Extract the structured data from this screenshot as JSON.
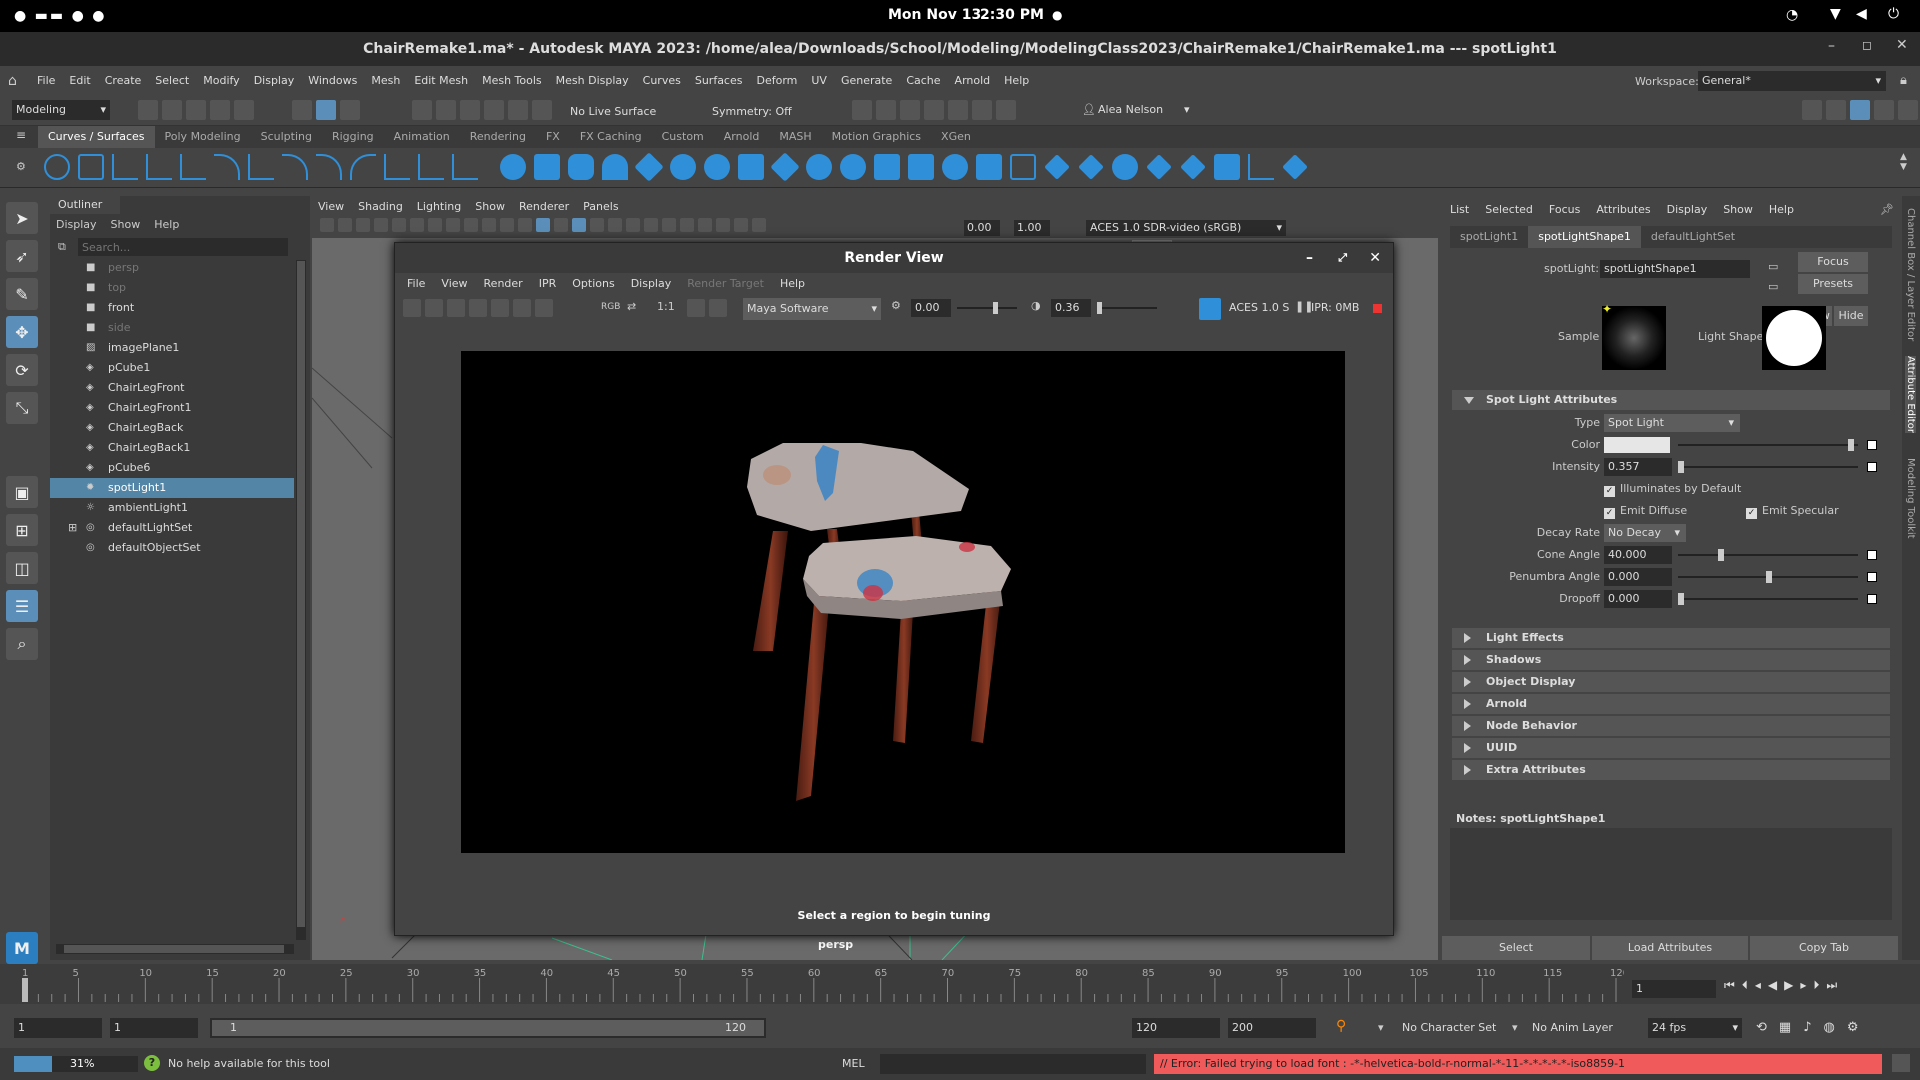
{
  "system": {
    "date": "Mon Nov 13",
    "time": "2:30 PM"
  },
  "window": {
    "title": "ChairRemake1.ma* - Autodesk MAYA 2023: /home/alea/Downloads/School/Modeling/ModelingClass2023/ChairRemake1/ChairRemake1.ma  ---  spotLight1"
  },
  "menu": [
    "File",
    "Edit",
    "Create",
    "Select",
    "Modify",
    "Display",
    "Windows",
    "Mesh",
    "Edit Mesh",
    "Mesh Tools",
    "Mesh Display",
    "Curves",
    "Surfaces",
    "Deform",
    "UV",
    "Generate",
    "Cache",
    "Arnold",
    "Help"
  ],
  "workspace": {
    "label": "Workspace:",
    "value": "General*"
  },
  "statusline": {
    "mode": "Modeling",
    "live_surface": "No Live Surface",
    "symmetry": "Symmetry: Off",
    "user": "Alea Nelson"
  },
  "shelf_tabs": [
    "Curves / Surfaces",
    "Poly Modeling",
    "Sculpting",
    "Rigging",
    "Animation",
    "Rendering",
    "FX",
    "FX Caching",
    "Custom",
    "Arnold",
    "MASH",
    "Motion Graphics",
    "XGen"
  ],
  "outliner": {
    "title": "Outliner",
    "menu": [
      "Display",
      "Show",
      "Help"
    ],
    "search_placeholder": "Search...",
    "items": [
      {
        "label": "persp",
        "icon": "camera-icon",
        "dim": true
      },
      {
        "label": "top",
        "icon": "camera-icon",
        "dim": true
      },
      {
        "label": "front",
        "icon": "camera-icon",
        "dim": false
      },
      {
        "label": "side",
        "icon": "camera-icon",
        "dim": true
      },
      {
        "label": "imagePlane1",
        "icon": "image-plane-icon",
        "dim": false
      },
      {
        "label": "pCube1",
        "icon": "mesh-icon",
        "dim": false
      },
      {
        "label": "ChairLegFront",
        "icon": "mesh-icon",
        "dim": false
      },
      {
        "label": "ChairLegFront1",
        "icon": "mesh-icon",
        "dim": false
      },
      {
        "label": "ChairLegBack",
        "icon": "mesh-icon",
        "dim": false
      },
      {
        "label": "ChairLegBack1",
        "icon": "mesh-icon",
        "dim": false
      },
      {
        "label": "pCube6",
        "icon": "mesh-icon",
        "dim": false
      },
      {
        "label": "spotLight1",
        "icon": "spotlight-icon",
        "dim": false,
        "selected": true
      },
      {
        "label": "ambientLight1",
        "icon": "ambient-light-icon",
        "dim": false
      },
      {
        "label": "defaultLightSet",
        "icon": "set-icon",
        "dim": false,
        "expandable": true
      },
      {
        "label": "defaultObjectSet",
        "icon": "set-icon",
        "dim": false
      }
    ]
  },
  "viewport": {
    "menu": [
      "View",
      "Shading",
      "Lighting",
      "Show",
      "Renderer",
      "Panels"
    ],
    "exposure": "0.00",
    "gamma": "1.00",
    "color_space": "ACES 1.0 SDR-video (sRGB)",
    "camera_label": "persp"
  },
  "render_view": {
    "title": "Render View",
    "menu": [
      "File",
      "View",
      "Render",
      "IPR",
      "Options",
      "Display",
      "Render Target",
      "Help"
    ],
    "renderer": "Maya Software",
    "exposure": "0.00",
    "gamma": "0.36",
    "color_space": "ACES 1.0 S",
    "ipr": "IPR: 0MB",
    "ratio": "1:1",
    "rgb": "RGB",
    "status": "Select a region to begin tuning"
  },
  "attr": {
    "menu": [
      "List",
      "Selected",
      "Focus",
      "Attributes",
      "Display",
      "Show",
      "Help"
    ],
    "tabs": [
      "spotLight1",
      "spotLightShape1",
      "defaultLightSet"
    ],
    "node_label": "spotLight:",
    "node_value": "spotLightShape1",
    "buttons": {
      "focus": "Focus",
      "presets": "Presets",
      "show": "Show",
      "hide": "Hide"
    },
    "sample_label": "Sample",
    "light_shape_label": "Light Shape",
    "section_open": "Spot Light Attributes",
    "type_label": "Type",
    "type_value": "Spot Light",
    "color_label": "Color",
    "intensity_label": "Intensity",
    "intensity_value": "0.357",
    "illuminates": "Illuminates by Default",
    "emit_diffuse": "Emit Diffuse",
    "emit_specular": "Emit Specular",
    "decay_label": "Decay Rate",
    "decay_value": "No Decay",
    "cone_label": "Cone Angle",
    "cone_value": "40.000",
    "penumbra_label": "Penumbra Angle",
    "penumbra_value": "0.000",
    "dropoff_label": "Dropoff",
    "dropoff_value": "0.000",
    "sections": [
      "Light Effects",
      "Shadows",
      "Object Display",
      "Arnold",
      "Node Behavior",
      "UUID",
      "Extra Attributes"
    ],
    "notes_label": "Notes:  spotLightShape1",
    "bottom_buttons": [
      "Select",
      "Load Attributes",
      "Copy Tab"
    ]
  },
  "side_tabs": [
    "Channel Box / Layer Editor",
    "Attribute Editor",
    "Modeling Toolkit"
  ],
  "timeline": {
    "ticks": [
      "1",
      "5",
      "10",
      "15",
      "20",
      "25",
      "30",
      "35",
      "40",
      "45",
      "50",
      "55",
      "60",
      "65",
      "70",
      "75",
      "80",
      "85",
      "90",
      "95",
      "100",
      "105",
      "110",
      "115",
      "120"
    ],
    "current_frame": "1"
  },
  "range": {
    "start": "1",
    "anim_start": "1",
    "slider_start": "1",
    "slider_end": "120",
    "end": "120",
    "anim_end": "200",
    "character_set": "No Character Set",
    "anim_layer": "No Anim Layer",
    "fps": "24 fps"
  },
  "cmdline": {
    "progress": "31%",
    "help": "No help available for this tool",
    "lang": "MEL",
    "error": "// Error: Failed trying to load font : -*-helvetica-bold-r-normal-*-11-*-*-*-*-*-iso8859-1"
  },
  "colors": {
    "accent": "#5285a6",
    "shelf_blue": "#2f8fd8",
    "error_bg": "#f05a5a"
  }
}
